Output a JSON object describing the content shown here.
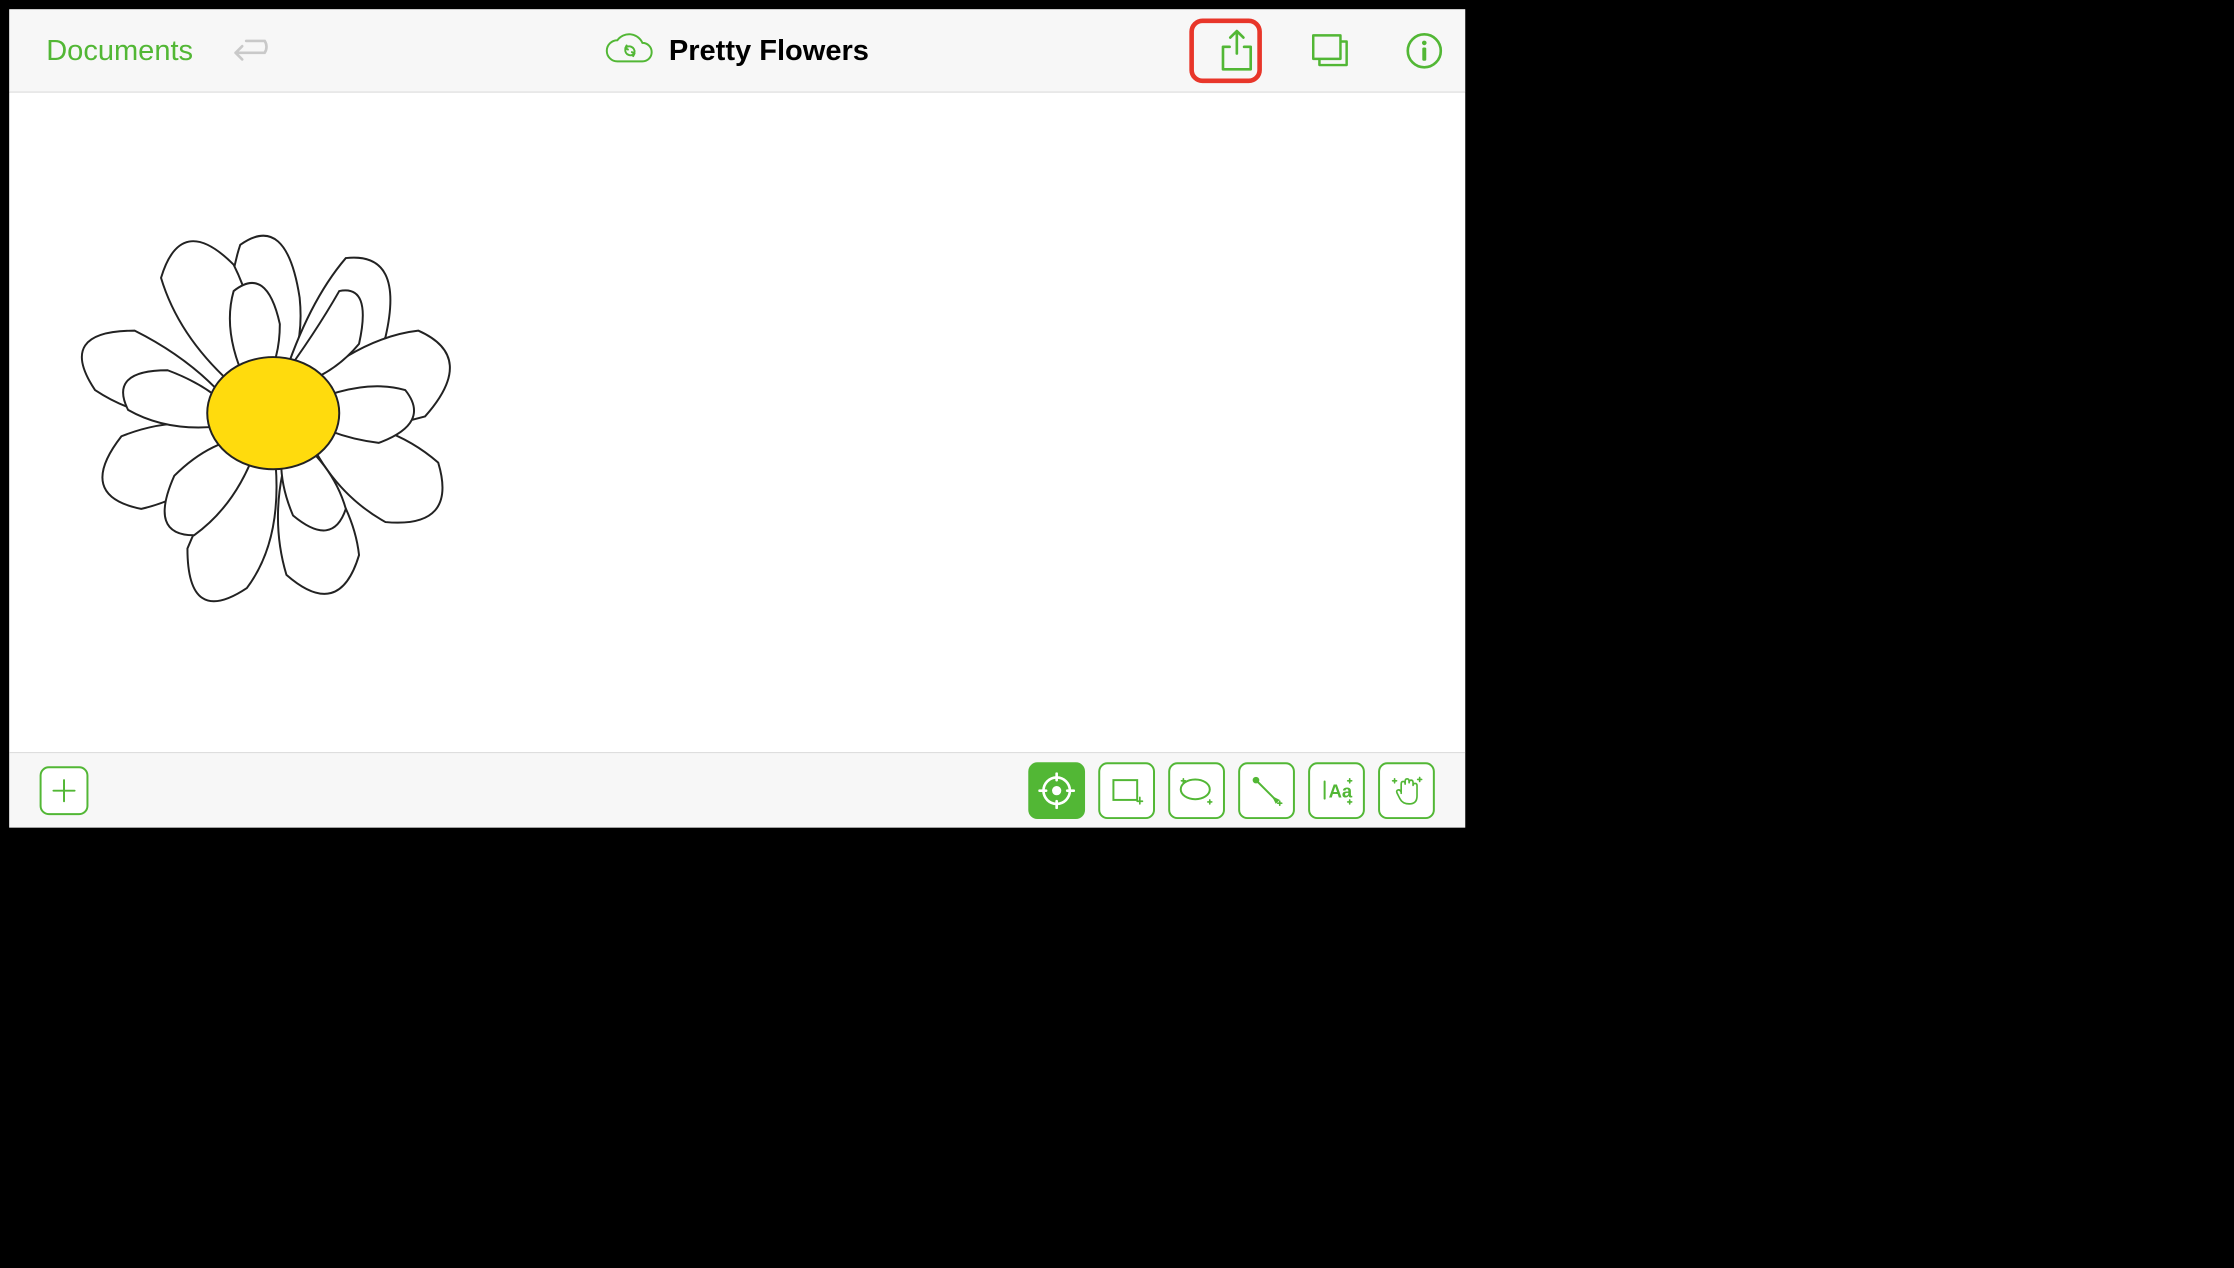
{
  "toolbar": {
    "documents_label": "Documents",
    "title": "Pretty Flowers"
  },
  "colors": {
    "accent": "#52b735",
    "highlight": "#e8362a",
    "flower_center": "#ffdb0d"
  },
  "bottom_tools": {
    "active_tool": "crosshair"
  }
}
